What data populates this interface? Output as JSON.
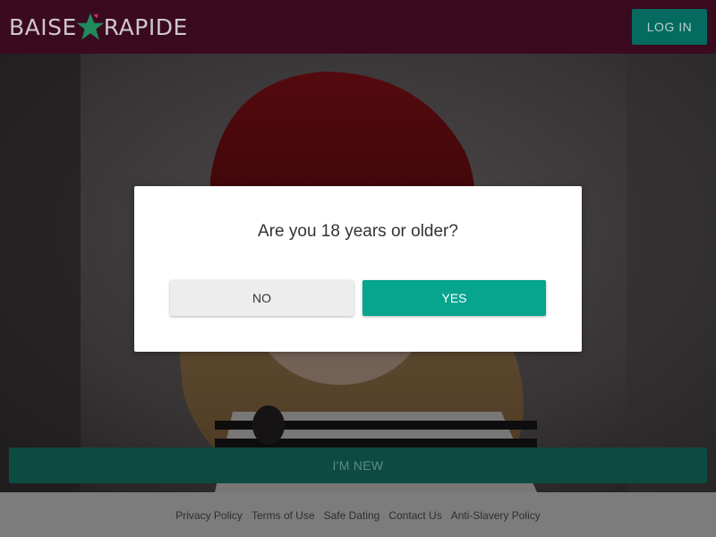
{
  "header": {
    "logo_left": "BAISE",
    "logo_right": "RAPIDE",
    "login_label": "LOG IN"
  },
  "hero": {
    "new_label": "I'M NEW"
  },
  "modal": {
    "question": "Are you 18 years or older?",
    "no_label": "NO",
    "yes_label": "YES"
  },
  "footer": {
    "links": [
      "Privacy Policy",
      "Terms of Use",
      "Safe Dating",
      "Contact Us",
      "Anti-Slavery Policy"
    ]
  },
  "colors": {
    "header_bg": "#3a0a1f",
    "accent": "#07a48e",
    "login_bg": "#056a5f",
    "star_green": "#1f8a5a",
    "star_pink": "#c9306b"
  }
}
